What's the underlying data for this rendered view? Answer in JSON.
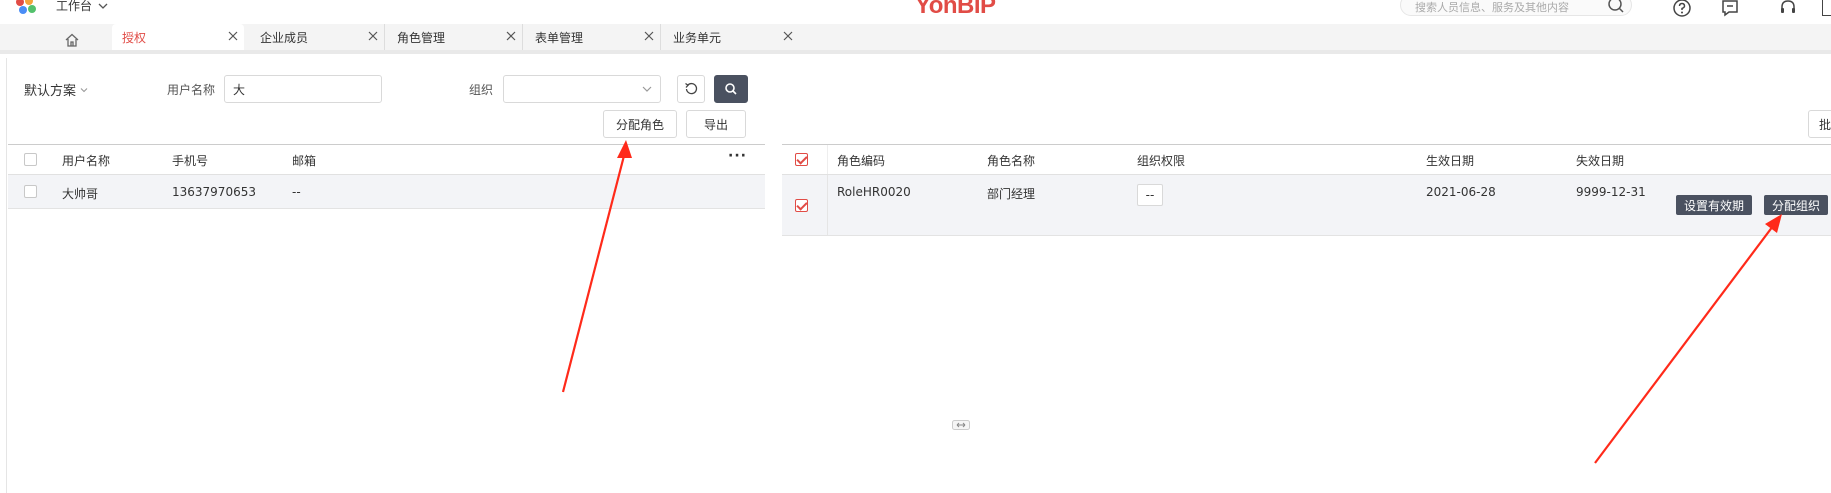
{
  "topbar": {
    "workbench_label": "工作台",
    "brand": "YonBIP",
    "search_placeholder": "搜索人员信息、服务及其他内容",
    "icons": [
      "search-icon",
      "help-icon",
      "message-icon",
      "headset-icon"
    ]
  },
  "tabs": {
    "home_icon": "home-icon",
    "items": [
      {
        "label": "授权",
        "active": true
      },
      {
        "label": "企业成员",
        "active": false
      },
      {
        "label": "角色管理",
        "active": false
      },
      {
        "label": "表单管理",
        "active": false
      },
      {
        "label": "业务单元",
        "active": false
      }
    ]
  },
  "filter": {
    "scheme_label": "默认方案",
    "username_label": "用户名称",
    "username_value": "大",
    "org_label": "组织",
    "org_value": ""
  },
  "left_actions": {
    "assign_role": "分配角色",
    "export": "导出"
  },
  "user_table": {
    "columns": [
      "用户名称",
      "手机号",
      "邮箱"
    ],
    "rows": [
      {
        "name": "大帅哥",
        "phone": "13637970653",
        "email": "--"
      }
    ]
  },
  "right_actions": {
    "partial_button": "批"
  },
  "role_table": {
    "columns": [
      "角色编码",
      "角色名称",
      "组织权限",
      "生效日期",
      "失效日期"
    ],
    "rows": [
      {
        "code": "RoleHR0020",
        "name": "部门经理",
        "org_permission": "--",
        "effective_date": "2021-06-28",
        "expiry_date": "9999-12-31",
        "set_validity_button": "设置有效期",
        "assign_org_button": "分配组织"
      }
    ]
  },
  "colors": {
    "accent": "#e14c46",
    "dark_button": "#4a5160",
    "row_highlight": "#f3f4f7"
  }
}
